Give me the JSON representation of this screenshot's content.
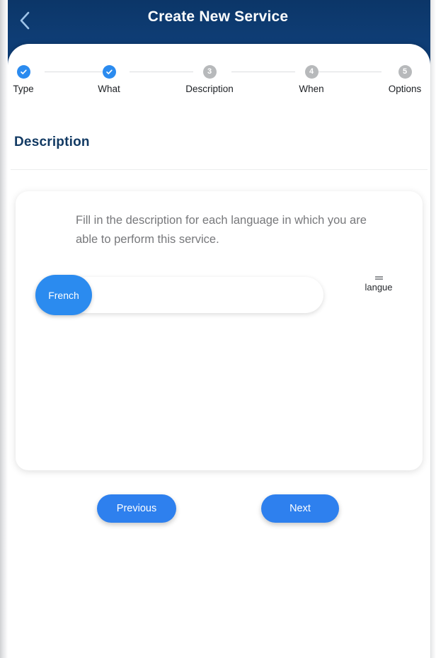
{
  "header": {
    "title": "Create New Service",
    "back_icon": "chevron-left-icon"
  },
  "stepper": {
    "steps": [
      {
        "number": "1",
        "label": "Type",
        "state": "done"
      },
      {
        "number": "2",
        "label": "What",
        "state": "done"
      },
      {
        "number": "3",
        "label": "Description",
        "state": "todo"
      },
      {
        "number": "4",
        "label": "When",
        "state": "todo"
      },
      {
        "number": "5",
        "label": "Options",
        "state": "todo"
      }
    ]
  },
  "section": {
    "title": "Description"
  },
  "card": {
    "instruction": "Fill in the description for each language in which you are able to perform this service.",
    "language_row": {
      "pill_label": "French",
      "input_value": "",
      "input_placeholder": "",
      "meta_icon": "list-lines-icon",
      "meta_label": "langue"
    }
  },
  "footer": {
    "previous_label": "Previous",
    "next_label": "Next"
  },
  "colors": {
    "header_navy": "#0e3d75",
    "accent_blue": "#2b8bef",
    "button_blue": "#2e80ee",
    "step_todo_gray": "#b7b9bb",
    "title_navy": "#123a63",
    "body_gray": "#77787b"
  }
}
